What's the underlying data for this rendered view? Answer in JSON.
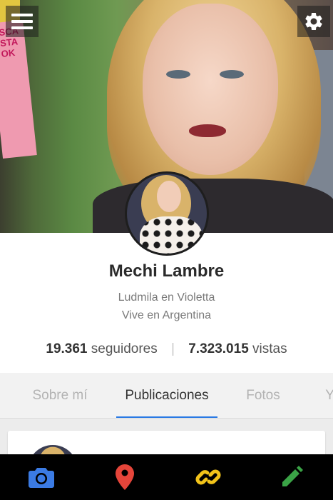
{
  "cover": {
    "poster_text": "SCA\nSTA\nOK"
  },
  "profile": {
    "name": "Mechi Lambre",
    "line1": "Ludmila en Violetta",
    "line2": "Vive en Argentina",
    "followers_count": "19.361",
    "followers_label": "seguidores",
    "views_count": "7.323.015",
    "views_label": "vistas"
  },
  "tabs": [
    {
      "label": "Sobre mí"
    },
    {
      "label": "Publicaciones"
    },
    {
      "label": "Fotos"
    },
    {
      "label": "Yo"
    }
  ],
  "active_tab": "Publicaciones",
  "colors": {
    "accent_blue": "#2a7ae4",
    "camera": "#3b7be4",
    "location": "#e5453a",
    "link": "#f2c31a",
    "edit": "#3aa346"
  },
  "bottom_actions": [
    {
      "icon": "camera-icon"
    },
    {
      "icon": "location-pin-icon"
    },
    {
      "icon": "link-icon"
    },
    {
      "icon": "pencil-icon"
    }
  ]
}
